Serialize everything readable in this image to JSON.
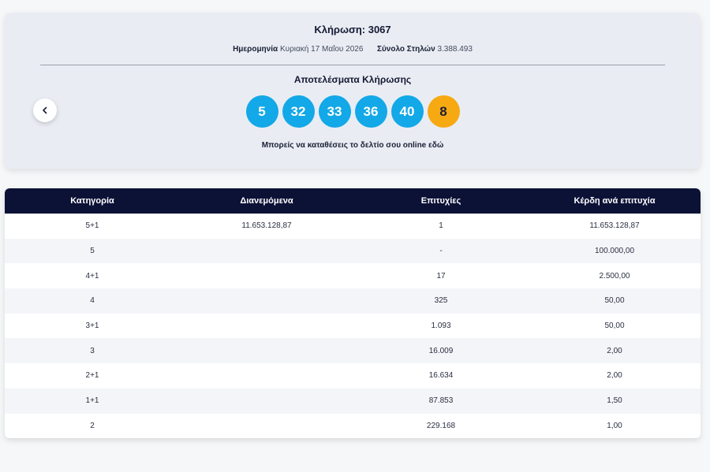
{
  "draw": {
    "title": "Κλήρωση: 3067",
    "date_label": "Ημερομηνία",
    "date_value": "Κυριακή 17 Μαΐου 2026",
    "columns_label": "Σύνολο Στηλών",
    "columns_value": "3.388.493",
    "results_title": "Αποτελέσματα Κλήρωσης",
    "numbers": [
      "5",
      "32",
      "33",
      "36",
      "40"
    ],
    "bonus": "8",
    "online_text": "Μπορείς να καταθέσεις το δελτίο σου online εδώ",
    "prev_icon": "chevron-left-icon"
  },
  "table": {
    "headers": [
      "Κατηγορία",
      "Διανεμόμενα",
      "Επιτυχίες",
      "Κέρδη ανά επιτυχία"
    ],
    "rows": [
      [
        "5+1",
        "11.653.128,87",
        "1",
        "11.653.128,87"
      ],
      [
        "5",
        "",
        "-",
        "100.000,00"
      ],
      [
        "4+1",
        "",
        "17",
        "2.500,00"
      ],
      [
        "4",
        "",
        "325",
        "50,00"
      ],
      [
        "3+1",
        "",
        "1.093",
        "50,00"
      ],
      [
        "3",
        "",
        "16.009",
        "2,00"
      ],
      [
        "2+1",
        "",
        "16.634",
        "2,00"
      ],
      [
        "1+1",
        "",
        "87.853",
        "1,50"
      ],
      [
        "2",
        "",
        "229.168",
        "1,00"
      ]
    ]
  },
  "colors": {
    "ball": "#13a8e7",
    "bonus_ball": "#f7a912",
    "table_header": "#0c1236"
  }
}
